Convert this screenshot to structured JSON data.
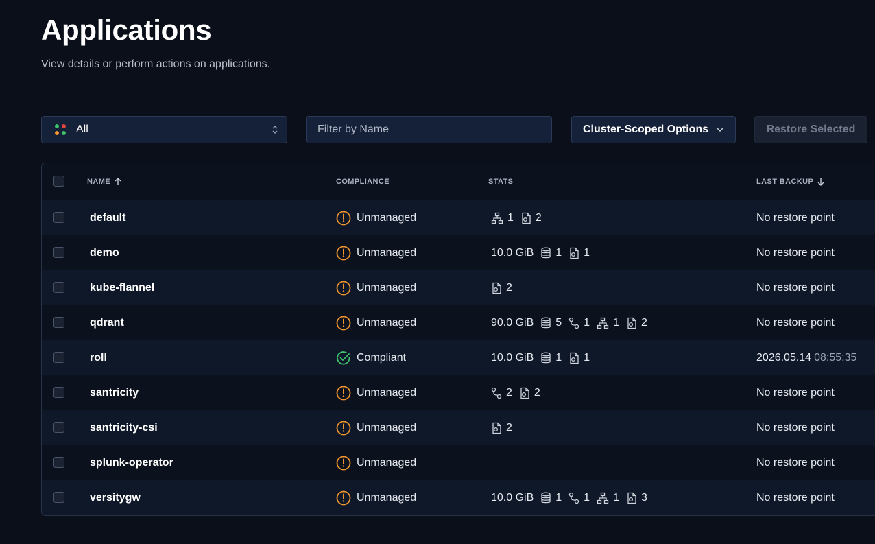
{
  "page": {
    "title": "Applications",
    "subtitle": "View details or perform actions on applications."
  },
  "toolbar": {
    "scope_select": "All",
    "filter_placeholder": "Filter by Name",
    "cluster_button": "Cluster-Scoped Options",
    "restore_button": "Restore Selected"
  },
  "table": {
    "columns": {
      "name": "NAME",
      "compliance": "COMPLIANCE",
      "stats": "STATS",
      "last_backup": "LAST BACKUP"
    },
    "rows": [
      {
        "name": "default",
        "compliance": "Unmanaged",
        "size": "",
        "volumes": "",
        "routes": "",
        "services": "1",
        "configs": "2",
        "last_backup": "No restore point",
        "last_time": ""
      },
      {
        "name": "demo",
        "compliance": "Unmanaged",
        "size": "10.0 GiB",
        "volumes": "1",
        "routes": "",
        "services": "",
        "configs": "1",
        "last_backup": "No restore point",
        "last_time": ""
      },
      {
        "name": "kube-flannel",
        "compliance": "Unmanaged",
        "size": "",
        "volumes": "",
        "routes": "",
        "services": "",
        "configs": "2",
        "last_backup": "No restore point",
        "last_time": ""
      },
      {
        "name": "qdrant",
        "compliance": "Unmanaged",
        "size": "90.0 GiB",
        "volumes": "5",
        "routes": "1",
        "services": "1",
        "configs": "2",
        "last_backup": "No restore point",
        "last_time": ""
      },
      {
        "name": "roll",
        "compliance": "Compliant",
        "size": "10.0 GiB",
        "volumes": "1",
        "routes": "",
        "services": "",
        "configs": "1",
        "last_backup": "2026.05.14",
        "last_time": "08:55:35"
      },
      {
        "name": "santricity",
        "compliance": "Unmanaged",
        "size": "",
        "volumes": "",
        "routes": "2",
        "services": "",
        "configs": "2",
        "last_backup": "No restore point",
        "last_time": ""
      },
      {
        "name": "santricity-csi",
        "compliance": "Unmanaged",
        "size": "",
        "volumes": "",
        "routes": "",
        "services": "",
        "configs": "2",
        "last_backup": "No restore point",
        "last_time": ""
      },
      {
        "name": "splunk-operator",
        "compliance": "Unmanaged",
        "size": "",
        "volumes": "",
        "routes": "",
        "services": "",
        "configs": "",
        "last_backup": "No restore point",
        "last_time": ""
      },
      {
        "name": "versitygw",
        "compliance": "Unmanaged",
        "size": "10.0 GiB",
        "volumes": "1",
        "routes": "1",
        "services": "1",
        "configs": "3",
        "last_backup": "No restore point",
        "last_time": ""
      }
    ]
  },
  "colors": {
    "warning": "#f0962e",
    "success": "#3ec26b",
    "background": "#0a0f1a"
  }
}
